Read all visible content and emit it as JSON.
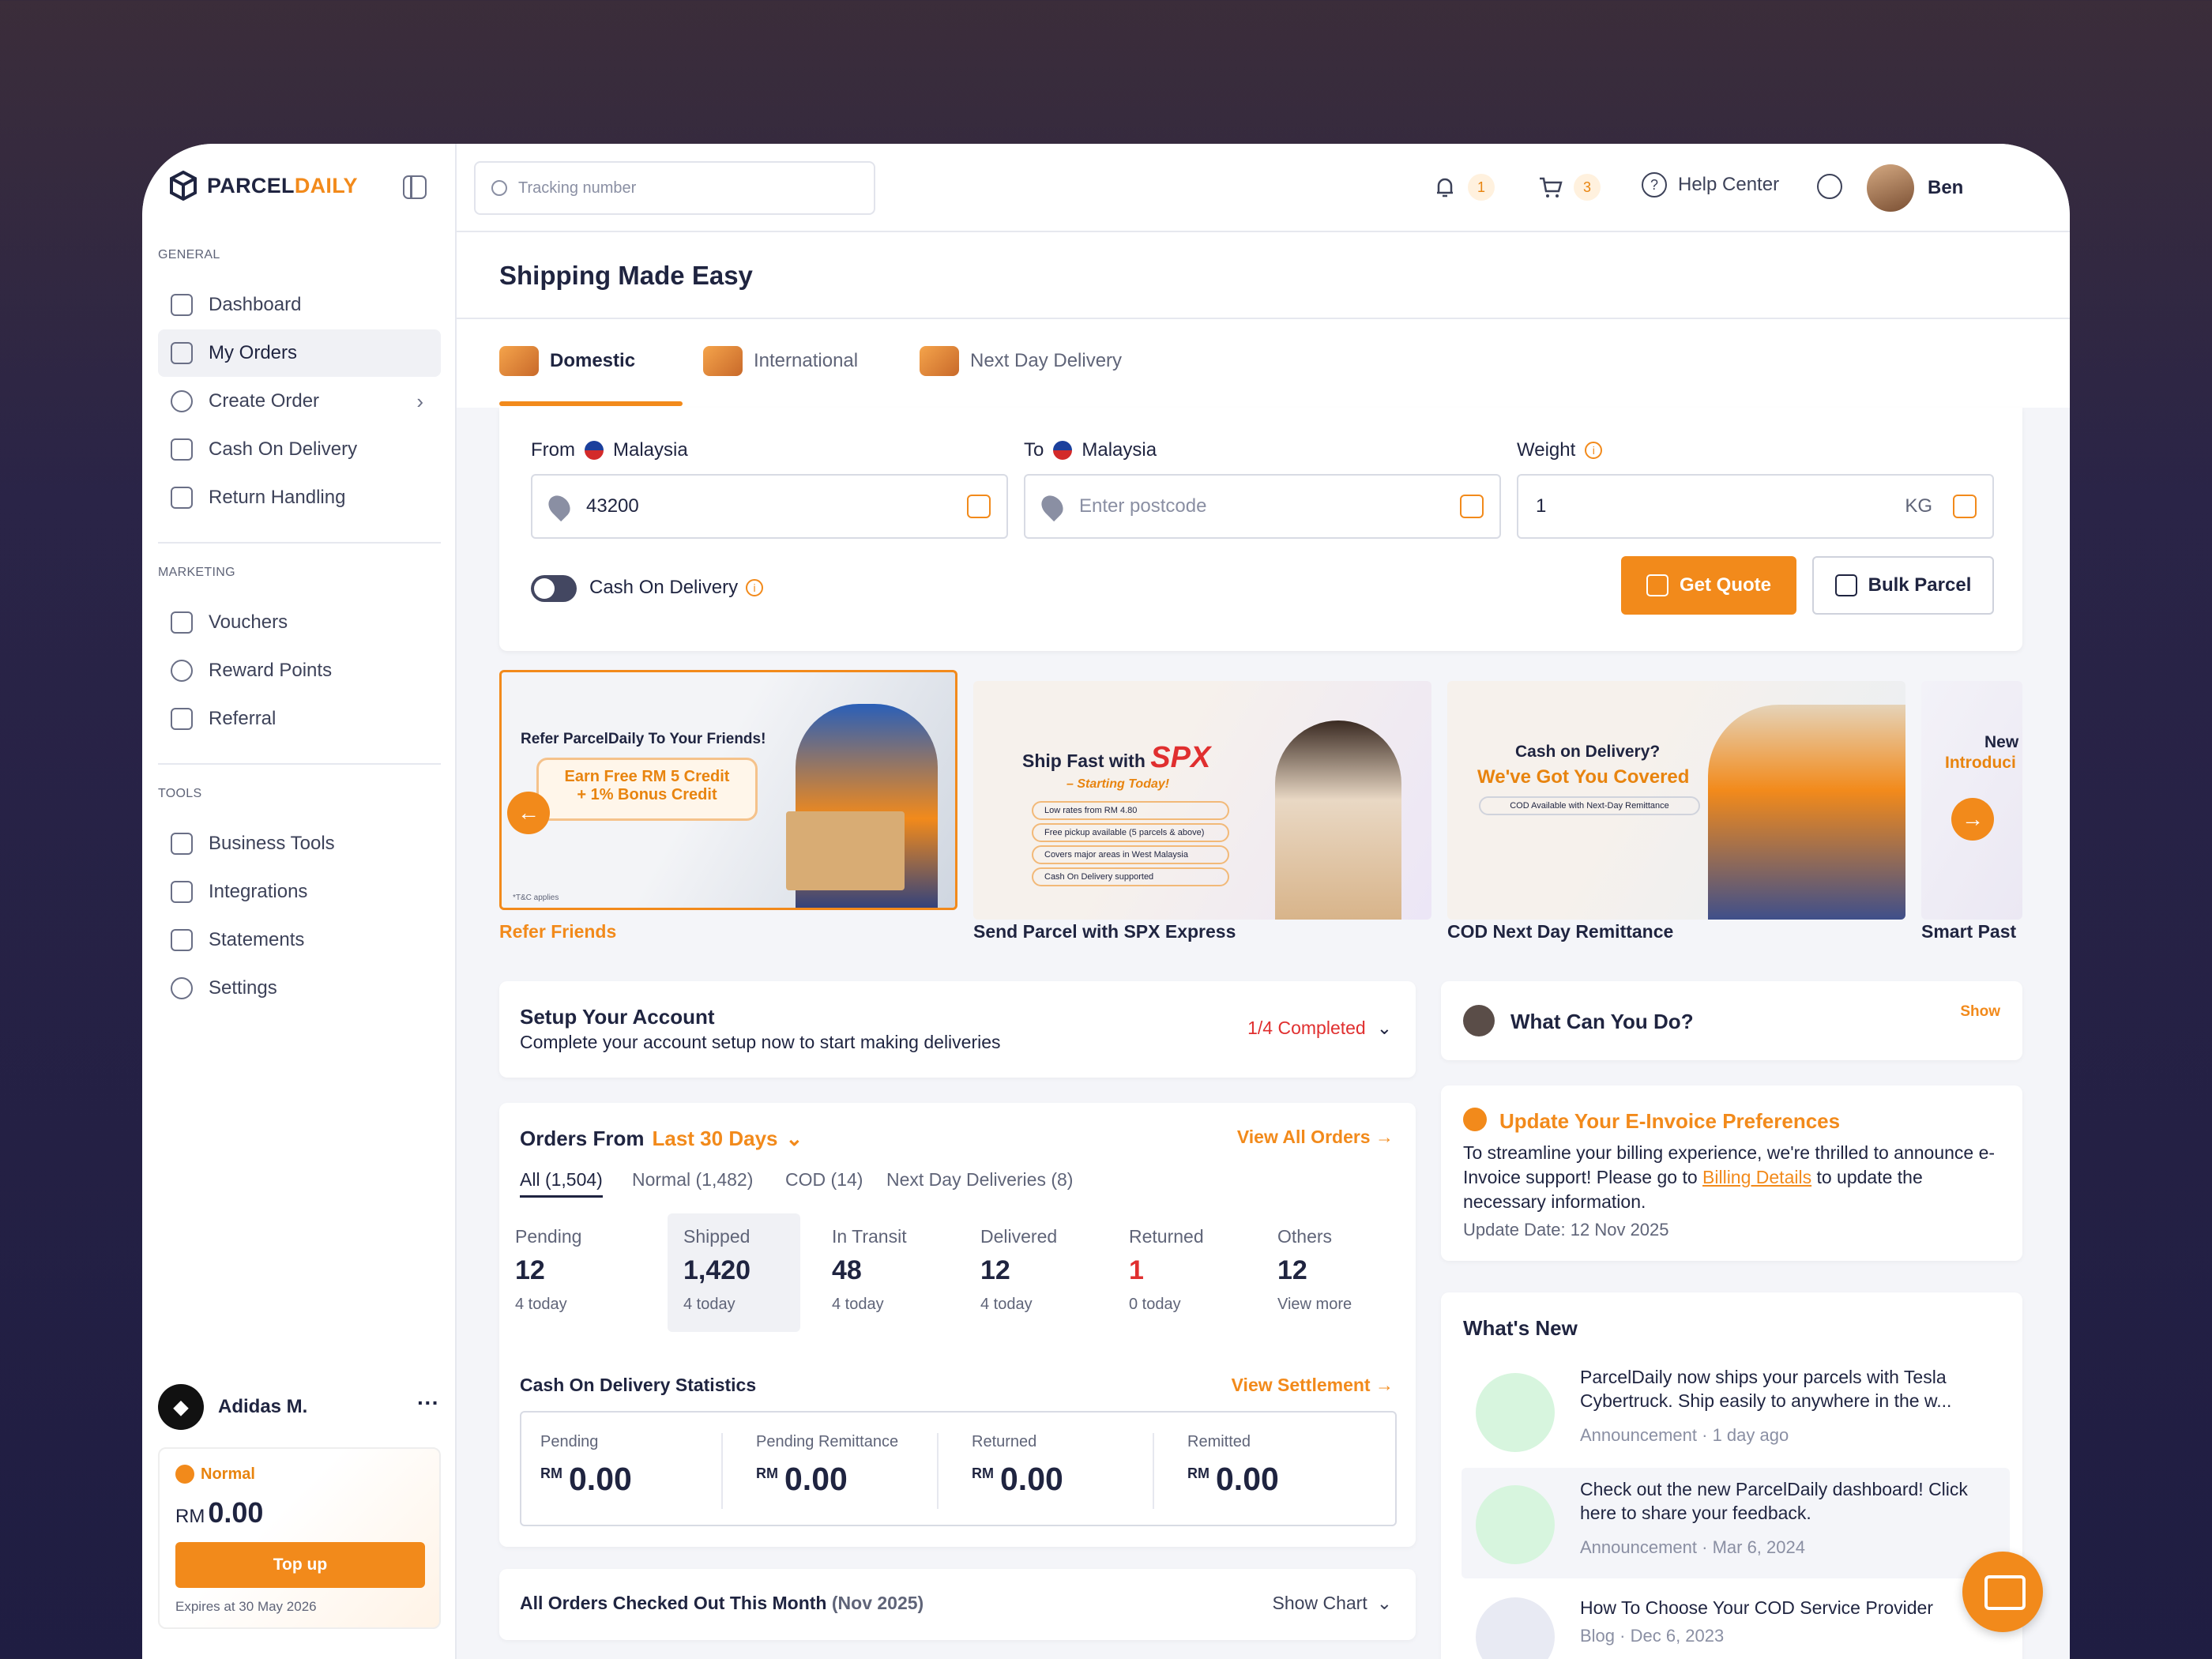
{
  "brand": {
    "p1": "PARCEL",
    "p2": "DAILY"
  },
  "search": {
    "placeholder": "Tracking number"
  },
  "header": {
    "notif_count": "1",
    "cart_count": "3",
    "help": "Help Center",
    "user": "Ben"
  },
  "sidebar": {
    "general": "GENERAL",
    "marketing": "MARKETING",
    "tools": "TOOLS",
    "items": [
      "Dashboard",
      "My Orders",
      "Create Order",
      "Cash On Delivery",
      "Return Handling",
      "Vouchers",
      "Reward Points",
      "Referral",
      "Business Tools",
      "Integrations",
      "Statements",
      "Settings"
    ],
    "account": "Adidas M.",
    "tier": "Normal",
    "balance_cur": "RM",
    "balance": "0.00",
    "topup": "Top up",
    "expires": "Expires at 30 May 2026"
  },
  "page": {
    "title": "Shipping Made Easy"
  },
  "tabs": [
    "Domestic",
    "International",
    "Next Day Delivery"
  ],
  "form": {
    "from": "From",
    "to": "To",
    "country": "Malaysia",
    "weight": "Weight",
    "from_value": "43200",
    "to_placeholder": "Enter postcode",
    "weight_value": "1",
    "unit": "KG",
    "cod": "Cash On Delivery",
    "get_quote": "Get Quote",
    "bulk": "Bulk Parcel"
  },
  "banners": [
    {
      "caption": "Refer Friends",
      "title": "Refer ParcelDaily To Your Friends!",
      "line1": "Earn Free RM 5 Credit",
      "line2": "+ 1% Bonus Credit",
      "tc": "*T&C applies"
    },
    {
      "caption": "Send Parcel with SPX Express",
      "title": "Ship Fast with",
      "brand": "SPX",
      "sub": "– Starting Today!",
      "points": [
        "Low rates from RM 4.80",
        "Free pickup available (5 parcels & above)",
        "Covers major areas in West Malaysia",
        "Cash On Delivery supported"
      ]
    },
    {
      "caption": "COD Next Day Remittance",
      "title": "Cash on Delivery?",
      "title2": "We've Got You Covered",
      "pill": "COD Available with Next-Day Remittance"
    },
    {
      "caption": "Smart Past",
      "title": "New",
      "title2": "Introduci"
    }
  ],
  "setup": {
    "title": "Setup Your Account",
    "desc": "Complete your account setup now to start making deliveries",
    "progress": "1/4 Completed"
  },
  "orders": {
    "title": "Orders From",
    "range": "Last 30 Days",
    "view_all": "View All Orders →",
    "filters": [
      "All (1,504)",
      "Normal (1,482)",
      "COD (14)",
      "Next Day Deliveries (8)"
    ],
    "stats": [
      {
        "label": "Pending",
        "value": "12",
        "sub": "4 today"
      },
      {
        "label": "Shipped",
        "value": "1,420",
        "sub": "4 today"
      },
      {
        "label": "In Transit",
        "value": "48",
        "sub": "4 today"
      },
      {
        "label": "Delivered",
        "value": "12",
        "sub": "4 today"
      },
      {
        "label": "Returned",
        "value": "1",
        "sub": "0 today"
      },
      {
        "label": "Others",
        "value": "12",
        "sub": "View more"
      }
    ],
    "cod_title": "Cash On Delivery Statistics",
    "view_settlement": "View Settlement →",
    "cod": [
      {
        "label": "Pending",
        "cur": "RM",
        "value": "0.00"
      },
      {
        "label": "Pending Remittance",
        "cur": "RM",
        "value": "0.00"
      },
      {
        "label": "Returned",
        "cur": "RM",
        "value": "0.00"
      },
      {
        "label": "Remitted",
        "cur": "RM",
        "value": "0.00"
      }
    ]
  },
  "checked": {
    "title": "All Orders Checked Out This Month",
    "period": "(Nov 2025)",
    "show_chart": "Show Chart"
  },
  "whatcan": {
    "title": "What Can You Do?",
    "show": "Show"
  },
  "einvoice": {
    "title": "Update Your E-Invoice Preferences",
    "body1": "To streamline your billing experience, we're thrilled to announce e-Invoice support! Please go to",
    "link": "Billing Details",
    "body2": "to update the necessary information.",
    "date": "Update Date: 12 Nov 2025"
  },
  "whatsnew": {
    "title": "What's New",
    "items": [
      {
        "text": "ParcelDaily now ships your parcels with Tesla Cybertruck. Ship easily to anywhere in the w...",
        "tag": "Announcement",
        "time": "1 day ago"
      },
      {
        "text": "Check out the new ParcelDaily dashboard! Click here to share your feedback.",
        "tag": "Announcement",
        "time": "Mar 6, 2024"
      },
      {
        "text": "How To Choose Your COD Service Provider",
        "tag": "Blog",
        "time": "Dec 6, 2023"
      }
    ]
  },
  "colors": {
    "accent": "#f28a1b",
    "text": "#1f2440",
    "red": "#e02f2f"
  }
}
